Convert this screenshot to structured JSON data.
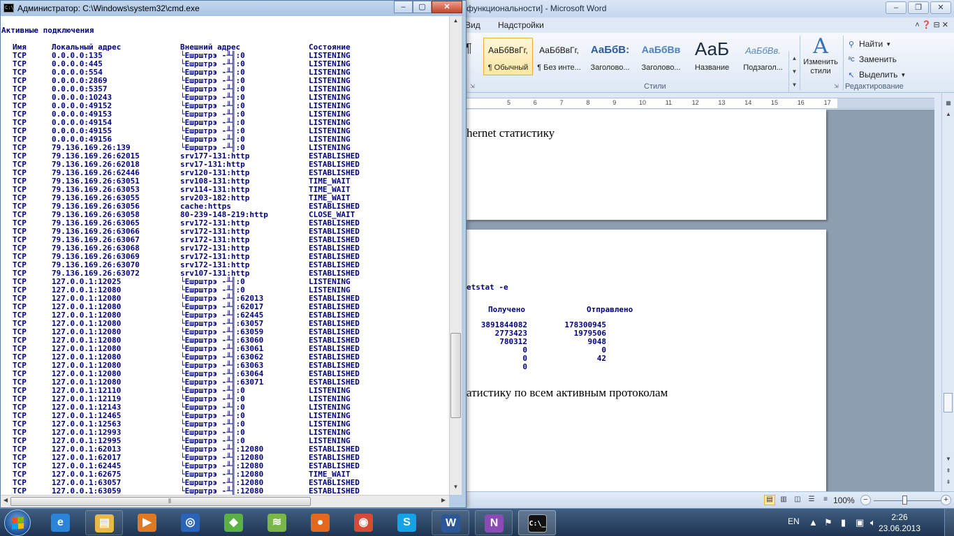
{
  "word": {
    "title": "функциональности] - Microsoft Word",
    "tabs": [
      "Вид",
      "Надстройки"
    ],
    "styles": [
      {
        "preview": "АаБбВвГг,",
        "name": "¶ Обычный",
        "selected": true,
        "kind": "normal"
      },
      {
        "preview": "АаБбВвГг,",
        "name": "¶ Без инте...",
        "selected": false,
        "kind": "normal"
      },
      {
        "preview": "АаБбВ:",
        "name": "Заголово...",
        "selected": false,
        "kind": "h1"
      },
      {
        "preview": "АаБбВв",
        "name": "Заголово...",
        "selected": false,
        "kind": "h2"
      },
      {
        "preview": "АаБ",
        "name": "Название",
        "selected": false,
        "kind": "ttl"
      },
      {
        "preview": "АаБбВв.",
        "name": "Подзагол...",
        "selected": false,
        "kind": "sub"
      }
    ],
    "change_styles_label": "Изменить стили",
    "styles_group_label": "Стили",
    "editing": {
      "find": "Найти",
      "replace": "Заменить",
      "select": "Выделить",
      "group_label": "Редактирование"
    },
    "ruler_ticks": [
      "5",
      "6",
      "7",
      "8",
      "9",
      "10",
      "11",
      "12",
      "13",
      "14",
      "15",
      "16",
      "17"
    ],
    "doc": {
      "line1": "hernet статистику",
      "snip_cmd": "etstat -e",
      "snip_header_recv": "Получено",
      "snip_header_sent": "Отправлено",
      "snip_rows": [
        [
          "3891844082",
          "178300945"
        ],
        [
          "2773423",
          "1979506"
        ],
        [
          "780312",
          "9048"
        ],
        [
          "0",
          "0"
        ],
        [
          "0",
          "42"
        ],
        [
          "0",
          ""
        ]
      ],
      "line2": "атистику по всем активным протоколам"
    },
    "zoom": "100%"
  },
  "cmd": {
    "title": "Администратор: C:\\Windows\\system32\\cmd.exe",
    "heading": "Активные подключения",
    "columns": [
      "Имя",
      "Локальный адрес",
      "Внешний адрес",
      "Состояние"
    ],
    "rows": [
      [
        "TCP",
        "0.0.0.0:135",
        "└Ешрштрэ -╨╢:0",
        "LISTENING"
      ],
      [
        "TCP",
        "0.0.0.0:445",
        "└Ешрштрэ -╨╢:0",
        "LISTENING"
      ],
      [
        "TCP",
        "0.0.0.0:554",
        "└Ешрштрэ -╨╢:0",
        "LISTENING"
      ],
      [
        "TCP",
        "0.0.0.0:2869",
        "└Ешрштрэ -╨╢:0",
        "LISTENING"
      ],
      [
        "TCP",
        "0.0.0.0:5357",
        "└Ешрштрэ -╨╢:0",
        "LISTENING"
      ],
      [
        "TCP",
        "0.0.0.0:10243",
        "└Ешрштрэ -╨╢:0",
        "LISTENING"
      ],
      [
        "TCP",
        "0.0.0.0:49152",
        "└Ешрштрэ -╨╢:0",
        "LISTENING"
      ],
      [
        "TCP",
        "0.0.0.0:49153",
        "└Ешрштрэ -╨╢:0",
        "LISTENING"
      ],
      [
        "TCP",
        "0.0.0.0:49154",
        "└Ешрштрэ -╨╢:0",
        "LISTENING"
      ],
      [
        "TCP",
        "0.0.0.0:49155",
        "└Ешрштрэ -╨╢:0",
        "LISTENING"
      ],
      [
        "TCP",
        "0.0.0.0:49156",
        "└Ешрштрэ -╨╢:0",
        "LISTENING"
      ],
      [
        "TCP",
        "79.136.169.26:139",
        "└Ешрштрэ -╨╢:0",
        "LISTENING"
      ],
      [
        "TCP",
        "79.136.169.26:62015",
        "srv177-131:http",
        "ESTABLISHED"
      ],
      [
        "TCP",
        "79.136.169.26:62018",
        "srv17-131:http",
        "ESTABLISHED"
      ],
      [
        "TCP",
        "79.136.169.26:62446",
        "srv120-131:http",
        "ESTABLISHED"
      ],
      [
        "TCP",
        "79.136.169.26:63051",
        "srv108-131:http",
        "TIME_WAIT"
      ],
      [
        "TCP",
        "79.136.169.26:63053",
        "srv114-131:http",
        "TIME_WAIT"
      ],
      [
        "TCP",
        "79.136.169.26:63055",
        "srv203-182:http",
        "TIME_WAIT"
      ],
      [
        "TCP",
        "79.136.169.26:63056",
        "cache:https",
        "ESTABLISHED"
      ],
      [
        "TCP",
        "79.136.169.26:63058",
        "80-239-148-219:http",
        "CLOSE_WAIT"
      ],
      [
        "TCP",
        "79.136.169.26:63065",
        "srv172-131:http",
        "ESTABLISHED"
      ],
      [
        "TCP",
        "79.136.169.26:63066",
        "srv172-131:http",
        "ESTABLISHED"
      ],
      [
        "TCP",
        "79.136.169.26:63067",
        "srv172-131:http",
        "ESTABLISHED"
      ],
      [
        "TCP",
        "79.136.169.26:63068",
        "srv172-131:http",
        "ESTABLISHED"
      ],
      [
        "TCP",
        "79.136.169.26:63069",
        "srv172-131:http",
        "ESTABLISHED"
      ],
      [
        "TCP",
        "79.136.169.26:63070",
        "srv172-131:http",
        "ESTABLISHED"
      ],
      [
        "TCP",
        "79.136.169.26:63072",
        "srv107-131:http",
        "ESTABLISHED"
      ],
      [
        "TCP",
        "127.0.0.1:12025",
        "└Ешрштрэ -╨╢:0",
        "LISTENING"
      ],
      [
        "TCP",
        "127.0.0.1:12080",
        "└Ешрштрэ -╨╢:0",
        "LISTENING"
      ],
      [
        "TCP",
        "127.0.0.1:12080",
        "└Ешрштрэ -╨╢:62013",
        "ESTABLISHED"
      ],
      [
        "TCP",
        "127.0.0.1:12080",
        "└Ешрштрэ -╨╢:62017",
        "ESTABLISHED"
      ],
      [
        "TCP",
        "127.0.0.1:12080",
        "└Ешрштрэ -╨╢:62445",
        "ESTABLISHED"
      ],
      [
        "TCP",
        "127.0.0.1:12080",
        "└Ешрштрэ -╨╢:63057",
        "ESTABLISHED"
      ],
      [
        "TCP",
        "127.0.0.1:12080",
        "└Ешрштрэ -╨╢:63059",
        "ESTABLISHED"
      ],
      [
        "TCP",
        "127.0.0.1:12080",
        "└Ешрштрэ -╨╢:63060",
        "ESTABLISHED"
      ],
      [
        "TCP",
        "127.0.0.1:12080",
        "└Ешрштрэ -╨╢:63061",
        "ESTABLISHED"
      ],
      [
        "TCP",
        "127.0.0.1:12080",
        "└Ешрштрэ -╨╢:63062",
        "ESTABLISHED"
      ],
      [
        "TCP",
        "127.0.0.1:12080",
        "└Ешрштрэ -╨╢:63063",
        "ESTABLISHED"
      ],
      [
        "TCP",
        "127.0.0.1:12080",
        "└Ешрштрэ -╨╢:63064",
        "ESTABLISHED"
      ],
      [
        "TCP",
        "127.0.0.1:12080",
        "└Ешрштрэ -╨╢:63071",
        "ESTABLISHED"
      ],
      [
        "TCP",
        "127.0.0.1:12110",
        "└Ешрштрэ -╨╢:0",
        "LISTENING"
      ],
      [
        "TCP",
        "127.0.0.1:12119",
        "└Ешрштрэ -╨╢:0",
        "LISTENING"
      ],
      [
        "TCP",
        "127.0.0.1:12143",
        "└Ешрштрэ -╨╢:0",
        "LISTENING"
      ],
      [
        "TCP",
        "127.0.0.1:12465",
        "└Ешрштрэ -╨╢:0",
        "LISTENING"
      ],
      [
        "TCP",
        "127.0.0.1:12563",
        "└Ешрштрэ -╨╢:0",
        "LISTENING"
      ],
      [
        "TCP",
        "127.0.0.1:12993",
        "└Ешрштрэ -╨╢:0",
        "LISTENING"
      ],
      [
        "TCP",
        "127.0.0.1:12995",
        "└Ешрштрэ -╨╢:0",
        "LISTENING"
      ],
      [
        "TCP",
        "127.0.0.1:62013",
        "└Ешрштрэ -╨╢:12080",
        "ESTABLISHED"
      ],
      [
        "TCP",
        "127.0.0.1:62017",
        "└Ешрштрэ -╨╢:12080",
        "ESTABLISHED"
      ],
      [
        "TCP",
        "127.0.0.1:62445",
        "└Ешрштрэ -╨╢:12080",
        "ESTABLISHED"
      ],
      [
        "TCP",
        "127.0.0.1:62675",
        "└Ешрштрэ -╨╢:12080",
        "TIME_WAIT"
      ],
      [
        "TCP",
        "127.0.0.1:63057",
        "└Ешрштрэ -╨╢:12080",
        "ESTABLISHED"
      ],
      [
        "TCP",
        "127.0.0.1:63059",
        "└Ешрштрэ -╨╢:12080",
        "ESTABLISHED"
      ]
    ]
  },
  "taskbar": {
    "apps": [
      {
        "name": "ie",
        "glyph": "e",
        "color": "#2b84d8",
        "state": "none"
      },
      {
        "name": "explorer",
        "glyph": "▤",
        "color": "#e8b84a",
        "state": "running"
      },
      {
        "name": "media-player",
        "glyph": "▶",
        "color": "#e07a22",
        "state": "none"
      },
      {
        "name": "browser-blue",
        "glyph": "◎",
        "color": "#2a64b8",
        "state": "none"
      },
      {
        "name": "chrome-canary",
        "glyph": "◆",
        "color": "#5bb144",
        "state": "none"
      },
      {
        "name": "wifi-app",
        "glyph": "≋",
        "color": "#7ab648",
        "state": "none"
      },
      {
        "name": "firefox",
        "glyph": "●",
        "color": "#e5691c",
        "state": "none"
      },
      {
        "name": "chrome",
        "glyph": "◉",
        "color": "#d84a38",
        "state": "none"
      },
      {
        "name": "skype",
        "glyph": "S",
        "color": "#16a3e5",
        "state": "none"
      },
      {
        "name": "word",
        "glyph": "W",
        "color": "#2b5797",
        "state": "running"
      },
      {
        "name": "onenote",
        "glyph": "N",
        "color": "#8a4bb5",
        "state": "running"
      },
      {
        "name": "cmd",
        "glyph": "C:\\_",
        "color": "#111111",
        "state": "active"
      }
    ],
    "lang": "EN",
    "time": "2:26",
    "date": "23.06.2013"
  }
}
